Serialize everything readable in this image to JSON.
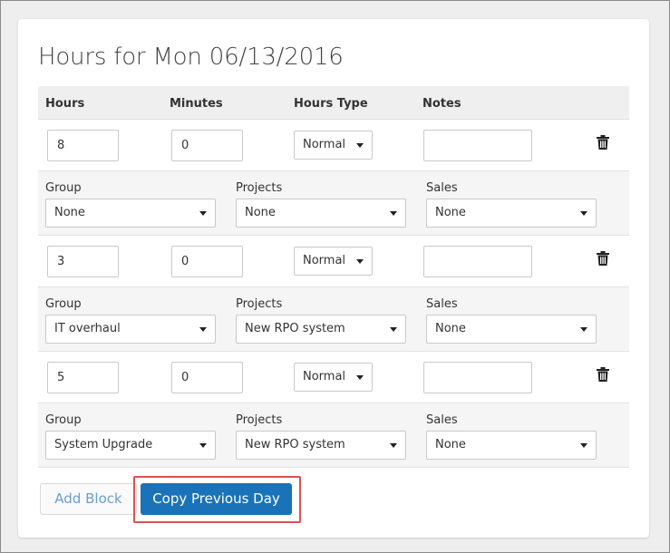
{
  "page": {
    "title": "Hours for Mon 06/13/2016"
  },
  "table": {
    "headers": {
      "hours": "Hours",
      "minutes": "Minutes",
      "hours_type": "Hours Type",
      "notes": "Notes"
    },
    "sub_labels": {
      "group": "Group",
      "projects": "Projects",
      "sales": "Sales"
    },
    "blocks": [
      {
        "hours": "8",
        "minutes": "0",
        "hours_type": "Normal",
        "notes": "",
        "group": "None",
        "projects": "None",
        "sales": "None"
      },
      {
        "hours": "3",
        "minutes": "0",
        "hours_type": "Normal",
        "notes": "",
        "group": "IT overhaul",
        "projects": "New RPO system",
        "sales": "None"
      },
      {
        "hours": "5",
        "minutes": "0",
        "hours_type": "Normal",
        "notes": "",
        "group": "System Upgrade",
        "projects": "New RPO system",
        "sales": "None"
      }
    ]
  },
  "actions": {
    "add_block": "Add Block",
    "copy_previous_day": "Copy Previous Day"
  },
  "icons": {
    "delete": "trash-icon",
    "dropdown": "chevron-down-icon"
  },
  "colors": {
    "primary": "#1a73b8",
    "highlight": "#d9534f",
    "link": "#6aa0cf"
  }
}
